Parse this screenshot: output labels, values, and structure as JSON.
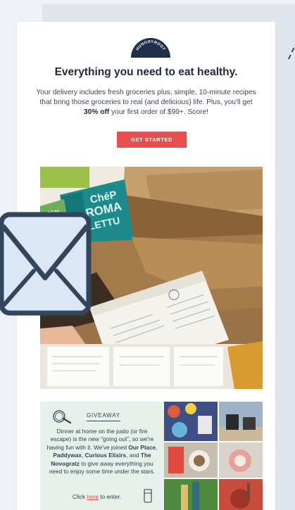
{
  "brand": {
    "name": "HUNGRYROOT"
  },
  "email": {
    "headline": "Everything you need to eat healthy.",
    "body_part1": "Your delivery includes fresh groceries plus, simple, 10-minute recipes that bring those groceries to real (and delicious) life. Plus, you'll get ",
    "body_bold": "30% off",
    "body_part2": " your first order of $99+. Score!",
    "cta_label": "GET STARTED"
  },
  "hero": {
    "package_text_1": "ChéP",
    "package_text_2": "ROMA",
    "package_text_3": "LETTU",
    "bag_text": "LOCAL"
  },
  "giveaway": {
    "title": "GIVEAWAY",
    "text_1": "Dinner at home on the patio (or fire escape) is the new \"going out\", so we're having fun with it. We've joined ",
    "brand_1": "Our Place",
    "sep_1": ", ",
    "brand_2": "Paddywax",
    "sep_2": ", ",
    "brand_3": "Curious Elixirs",
    "sep_3": ", and ",
    "brand_4": "The Novogratz",
    "text_2": " to give away everything you need to enjoy some time under the stars.",
    "click_prefix": "Click ",
    "click_link": "here",
    "click_suffix": " to enter."
  },
  "colors": {
    "accent": "#e84e4e",
    "navy": "#2d3e50",
    "giveaway_bg": "#e7f1ea",
    "envelope_fill": "#dbe7f6"
  },
  "icons": [
    "hungryroot-logo",
    "frying-pan-icon",
    "glass-icon",
    "mail-envelope-icon"
  ]
}
